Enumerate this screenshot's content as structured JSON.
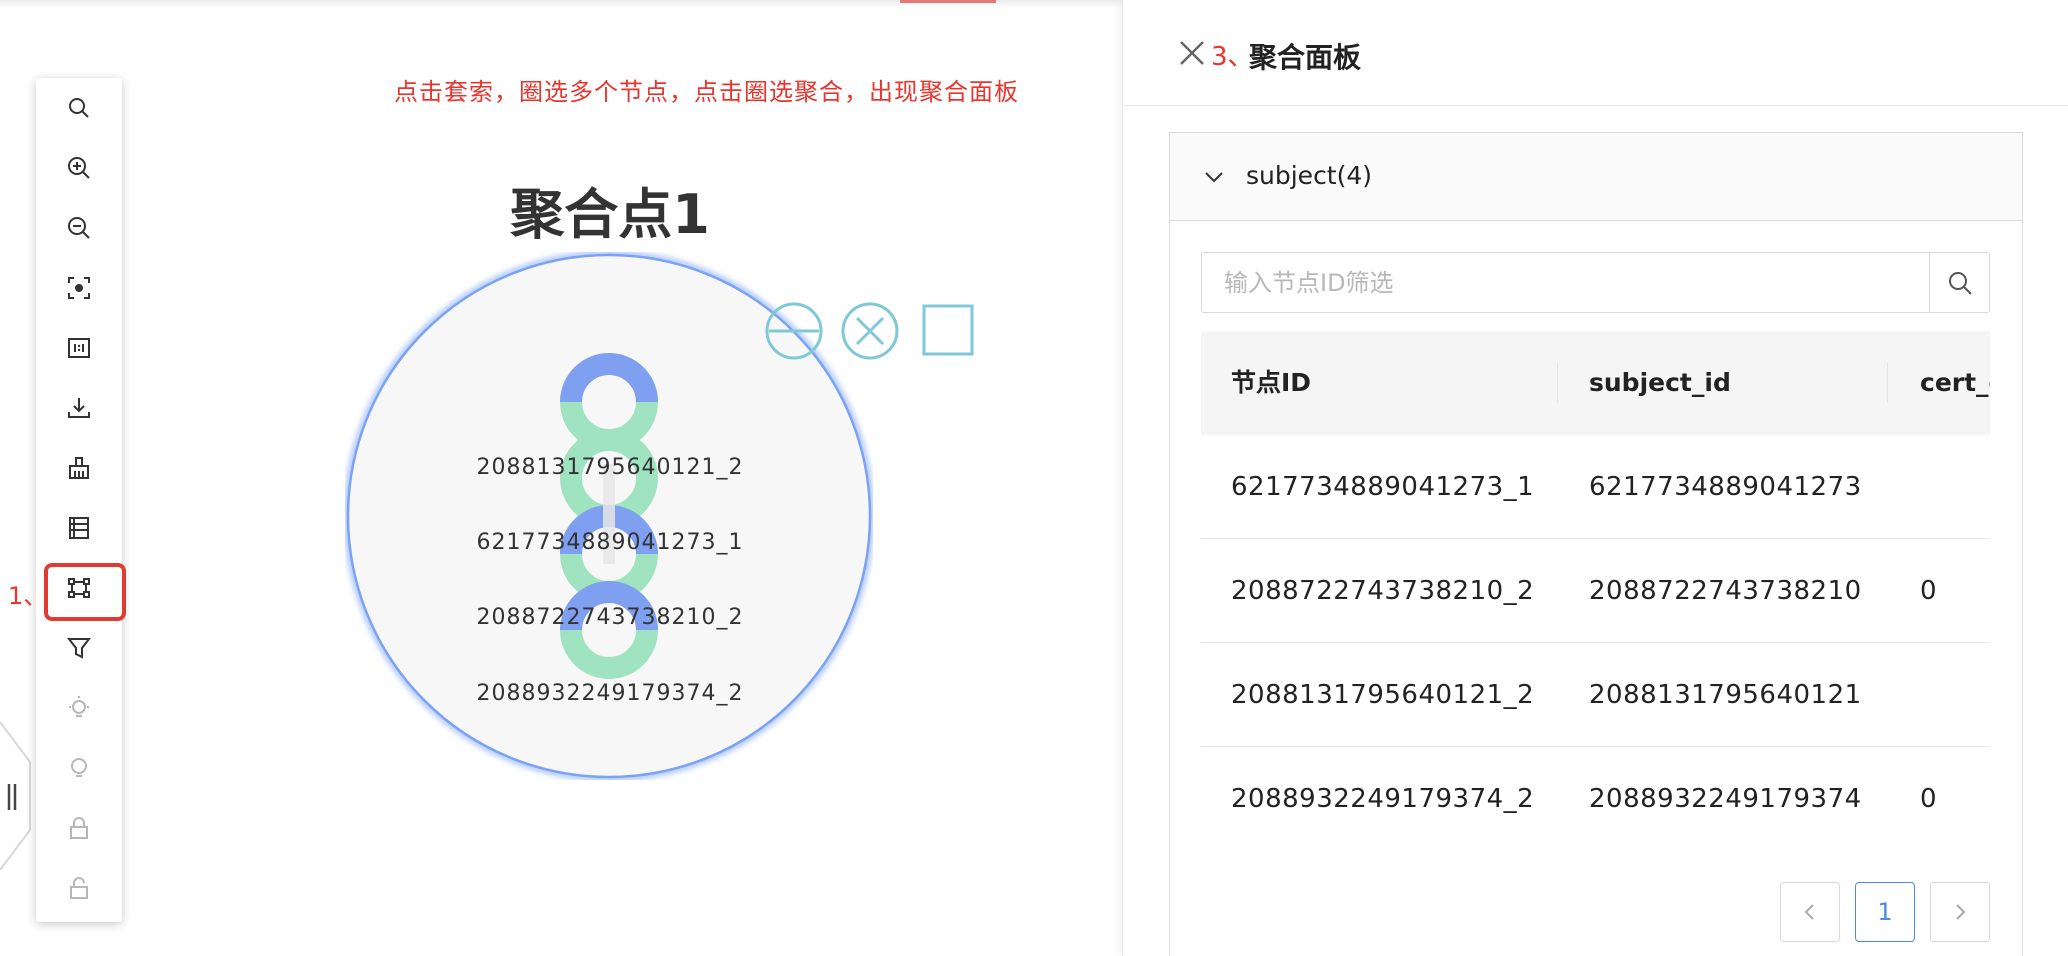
{
  "annotation": {
    "step1": "1、",
    "step3": "3、",
    "instruction": "点击套索，圈选多个节点，点击圈选聚合，出现聚合面板"
  },
  "toolbar": {
    "tools": [
      {
        "icon": "search-icon",
        "enabled": true
      },
      {
        "icon": "zoom-in-icon",
        "enabled": true
      },
      {
        "icon": "zoom-out-icon",
        "enabled": true
      },
      {
        "icon": "fit-view-icon",
        "enabled": true
      },
      {
        "icon": "actual-size-icon",
        "enabled": true
      },
      {
        "icon": "download-icon",
        "enabled": true
      },
      {
        "icon": "clear-icon",
        "enabled": true
      },
      {
        "icon": "list-icon",
        "enabled": true
      },
      {
        "icon": "lasso-icon",
        "enabled": true,
        "selected": true
      },
      {
        "icon": "filter-icon",
        "enabled": true
      },
      {
        "icon": "highlight-on-icon",
        "enabled": false
      },
      {
        "icon": "highlight-off-icon",
        "enabled": false
      },
      {
        "icon": "lock-icon",
        "enabled": false
      },
      {
        "icon": "unlock-icon",
        "enabled": false
      }
    ]
  },
  "canvas": {
    "cluster_title": "聚合点1",
    "node_labels": [
      "2088131795640121_2",
      "6217734889041273_1",
      "2088722743738210_2",
      "2088932249179374_2"
    ],
    "controls": [
      "collapse-circle-icon",
      "close-circle-icon",
      "expand-square-icon"
    ]
  },
  "panel": {
    "title": "聚合面板",
    "group": {
      "title": "subject(4)",
      "search_placeholder": "输入节点ID筛选",
      "search_value": "",
      "columns": [
        "节点ID",
        "subject_id",
        "cert_c"
      ],
      "rows": [
        [
          "6217734889041273_1",
          "6217734889041273",
          ""
        ],
        [
          "2088722743738210_2",
          "2088722743738210",
          "0"
        ],
        [
          "2088131795640121_2",
          "2088131795640121",
          ""
        ],
        [
          "2088932249179374_2",
          "2088932249179374",
          "0"
        ]
      ],
      "pagination": {
        "current": "1"
      }
    }
  },
  "colors": {
    "annotation_red": "#e8352d",
    "cluster_ring": "#7aa3f5",
    "donut_blue": "#7f9ff0",
    "donut_green": "#9fe3c1",
    "control_teal": "#7fc8d6",
    "pager_active": "#4a8ae8"
  }
}
